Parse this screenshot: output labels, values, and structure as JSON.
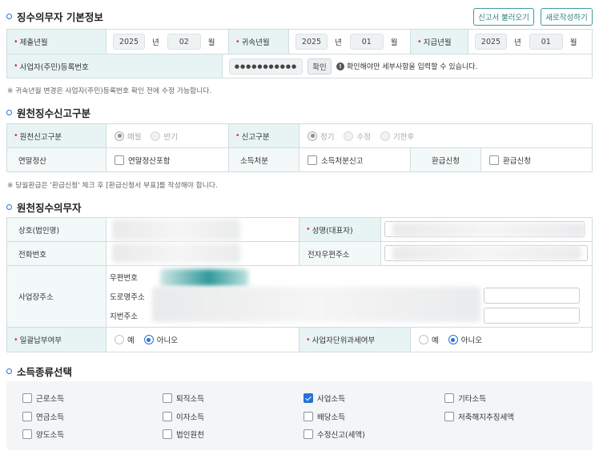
{
  "basic": {
    "title": "징수의무자 기본정보",
    "btn_load": "신고서 불러오기",
    "btn_new": "새로작성하기",
    "submit_label": "제출년월",
    "submit_year": "2025",
    "submit_month": "02",
    "attr_label": "귀속년월",
    "attr_year": "2025",
    "attr_month": "01",
    "pay_label": "지급년월",
    "pay_year": "2025",
    "pay_month": "01",
    "unit_year": "년",
    "unit_month": "월",
    "regno_label": "사업자(주민)등록번호",
    "regno_value": "●●●●●●●●●●●",
    "confirm_btn": "확인",
    "confirm_hint": "확인해야만 세부사항을 입력할 수 있습니다.",
    "info_icon": "info-icon",
    "note": "※ 귀속년월 변경은 사업자(주민)등록번호 확인 전에 수정 가능합니다."
  },
  "report_type": {
    "title": "원천징수신고구분",
    "type_label": "원천신고구분",
    "type_opts": [
      "매월",
      "반기"
    ],
    "type_selected": "매월",
    "report_label": "신고구분",
    "report_opts": [
      "정기",
      "수정",
      "기한후"
    ],
    "report_selected": "정기",
    "year_end_label": "연말정산",
    "year_end_chk": "연말정산포함",
    "disposal_label": "소득처분",
    "disposal_chk": "소득처분신고",
    "refund_label": "환급신청",
    "refund_chk": "환급신청",
    "note": "※ 당월환급은 '환급신청' 체크 후 [환급신청서 부표]를 작성해야 합니다."
  },
  "agent": {
    "title": "원천징수의무자",
    "company_label": "상호(법인명)",
    "name_label": "성명(대표자)",
    "phone_label": "전화번호",
    "email_label": "전자우편주소",
    "addr_label": "사업장주소",
    "zip_label": "우편번호",
    "road_label": "도로명주소",
    "lot_label": "지번주소",
    "bulk_label": "일괄납부여부",
    "bulk_opts": [
      "예",
      "아니오"
    ],
    "bulk_selected": "아니오",
    "unit_label": "사업자단위과세여부",
    "unit_opts": [
      "예",
      "아니오"
    ],
    "unit_selected": "아니오"
  },
  "income": {
    "title": "소득종류선택",
    "items": [
      {
        "label": "근로소득",
        "checked": false
      },
      {
        "label": "퇴직소득",
        "checked": false
      },
      {
        "label": "사업소득",
        "checked": true
      },
      {
        "label": "기타소득",
        "checked": false
      },
      {
        "label": "연금소득",
        "checked": false
      },
      {
        "label": "이자소득",
        "checked": false
      },
      {
        "label": "배당소득",
        "checked": false
      },
      {
        "label": "저축해지추징세액",
        "checked": false
      },
      {
        "label": "양도소득",
        "checked": false
      },
      {
        "label": "법인원천",
        "checked": false
      },
      {
        "label": "수정신고(세액)",
        "checked": false
      }
    ]
  },
  "colors": {
    "accent": "#2b6fd6",
    "teal": "#3f9c9a",
    "label_bg": "#e8f4f3",
    "required": "#d43a3a"
  }
}
